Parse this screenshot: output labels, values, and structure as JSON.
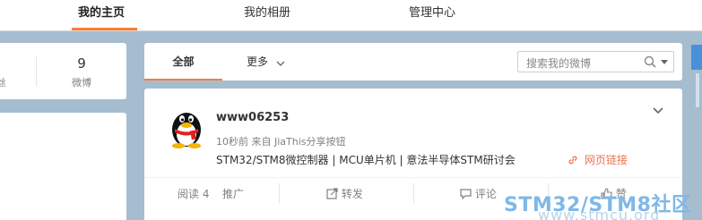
{
  "topnav": {
    "tabs": [
      {
        "label": "我的主页",
        "active": true
      },
      {
        "label": "我的相册",
        "active": false
      },
      {
        "label": "管理中心",
        "active": false
      }
    ]
  },
  "stats": {
    "weibo_count": "9",
    "weibo_label": "微博",
    "left_partial_label": "丝"
  },
  "filter": {
    "all_label": "全部",
    "more_label": "更多",
    "search_placeholder": "搜索我的微博"
  },
  "post": {
    "username": "www06253",
    "meta": "10秒前 来自 JiaThis分享按钮",
    "text": "STM32/STM8微控制器 | MCU单片机 | 意法半导体STM研讨会",
    "link_label": "网页链接",
    "actions": {
      "read": "阅读 4",
      "promote": "推广",
      "repost": "转发",
      "comment": "评论",
      "like": "赞"
    }
  },
  "watermark": {
    "title": "STM32/STM8社区",
    "url": "www.stmcu.org"
  },
  "colors": {
    "accent": "#fa7d3c",
    "link": "#eb7350",
    "background": "#a6bccf"
  }
}
